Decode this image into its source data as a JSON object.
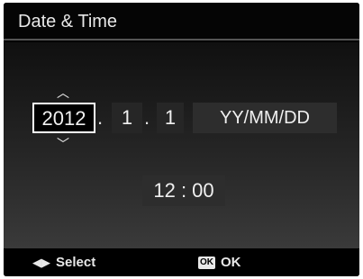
{
  "header": {
    "title": "Date & Time"
  },
  "date": {
    "year": "2012",
    "month": "1",
    "day": "1",
    "separator": ".",
    "format": "YY/MM/DD"
  },
  "time": {
    "value": "12 : 00"
  },
  "footer": {
    "select_label": "Select",
    "ok_badge": "OK",
    "ok_label": "OK"
  },
  "icons": {
    "up_arrow": "^",
    "down_arrow": "v",
    "nav": "◁▷"
  }
}
